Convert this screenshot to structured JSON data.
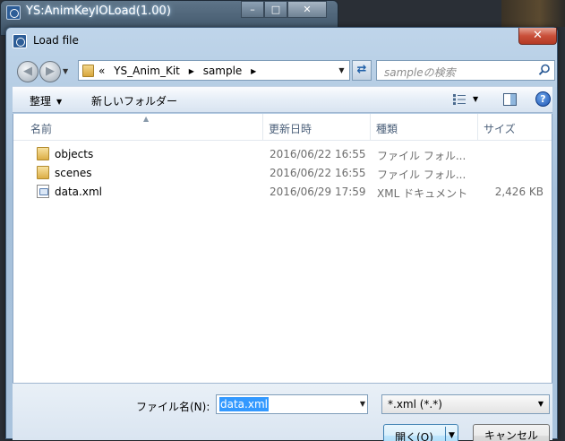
{
  "parent_window": {
    "title": "YS:AnimKeyIOLoad(1.00)",
    "minimize_glyph": "–",
    "maximize_glyph": "□",
    "close_glyph": "✕"
  },
  "dialog": {
    "title": "Load file",
    "close_glyph": "✕"
  },
  "nav": {
    "back_glyph": "◀",
    "forward_glyph": "▶",
    "address": {
      "prefix": "«",
      "segments": [
        "YS_Anim_Kit",
        "sample"
      ],
      "separator": "▶"
    },
    "refresh_glyph": "⇄",
    "search": {
      "placeholder": "sampleの検索"
    }
  },
  "toolbar": {
    "organize_label": "整理",
    "new_folder_label": "新しいフォルダー",
    "help_glyph": "?"
  },
  "columns": {
    "name": "名前",
    "date": "更新日時",
    "type": "種類",
    "size": "サイズ"
  },
  "files": [
    {
      "name": "objects",
      "date": "2016/06/22 16:55",
      "type": "ファイル フォル...",
      "size": "",
      "icon": "folder-icon"
    },
    {
      "name": "scenes",
      "date": "2016/06/22 16:55",
      "type": "ファイル フォル...",
      "size": "",
      "icon": "folder-icon"
    },
    {
      "name": "data.xml",
      "date": "2016/06/29 17:59",
      "type": "XML ドキュメント",
      "size": "2,426 KB",
      "icon": "xml-file-icon"
    }
  ],
  "bottom": {
    "filename_label": "ファイル名(N):",
    "filename_value": "data.xml",
    "filter_value": "*.xml (*.*)",
    "open_label": "開く(O)",
    "cancel_label": "キャンセル"
  },
  "colors": {
    "accent": "#3399ff",
    "titlebar": "#a6c0da",
    "close_button": "#c9503a"
  }
}
